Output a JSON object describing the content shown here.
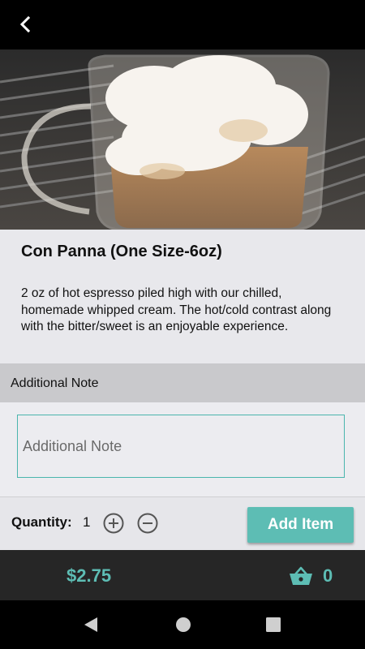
{
  "header": {
    "back_icon": "chevron-left-icon"
  },
  "hero": {
    "image": "espresso-con-panna-photo"
  },
  "product": {
    "title": "Con Panna (One Size-6oz)",
    "description": "2 oz of hot espresso piled high with our chilled, homemade whipped cream.  The hot/cold contrast along with the bitter/sweet is an enjoyable experience."
  },
  "note": {
    "header_label": "Additional Note",
    "placeholder": "Additional Note",
    "value": ""
  },
  "quantity": {
    "label": "Quantity:",
    "value": "1",
    "increase_icon": "plus-circle-icon",
    "decrease_icon": "minus-circle-icon"
  },
  "actions": {
    "add_label": "Add Item"
  },
  "cart": {
    "total": "$2.75",
    "count": "0",
    "icon": "basket-icon"
  },
  "colors": {
    "accent": "#5dbdb4",
    "cart_bar": "#262626",
    "top_bar": "#000000"
  },
  "system_nav": {
    "back_icon": "triangle-back-icon",
    "home_icon": "circle-home-icon",
    "recent_icon": "square-recent-icon"
  }
}
